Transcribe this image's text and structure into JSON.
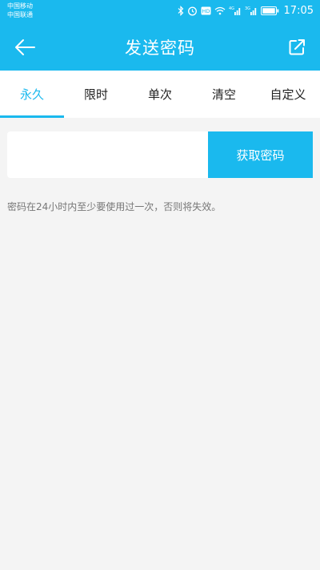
{
  "status_bar": {
    "carrier_1": "中国移动",
    "carrier_2": "中国联通",
    "icons": [
      "bluetooth-icon",
      "alarm-icon",
      "hd-icon",
      "wifi-icon",
      "signal-4g-icon",
      "signal-3g-icon",
      "battery-icon"
    ],
    "time": "17:05"
  },
  "header": {
    "title": "发送密码",
    "back_icon": "arrow-left-icon",
    "share_icon": "share-external-icon",
    "background": "#1ab9ee"
  },
  "tabs": [
    {
      "label": "永久",
      "active": true
    },
    {
      "label": "限时",
      "active": false
    },
    {
      "label": "单次",
      "active": false
    },
    {
      "label": "清空",
      "active": false
    },
    {
      "label": "自定义",
      "active": false
    }
  ],
  "password_form": {
    "input_value": "",
    "button_label": "获取密码"
  },
  "hint": "密码在24小时内至少要使用过一次，否则将失效。",
  "colors": {
    "accent": "#1ab9ee",
    "page_bg": "#f4f4f4"
  }
}
